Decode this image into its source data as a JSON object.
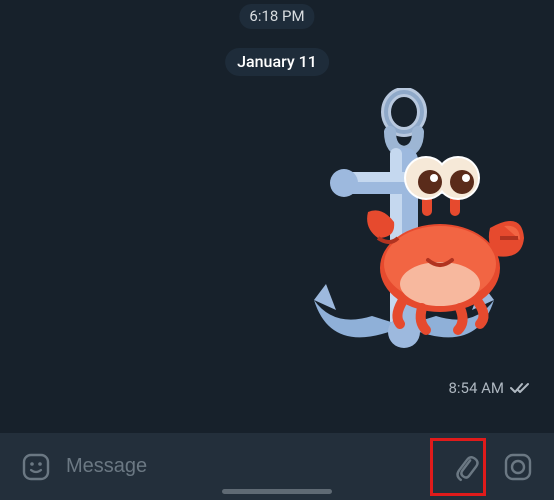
{
  "chat": {
    "prev_time": "6:18 PM",
    "date_separator": "January 11",
    "message": {
      "time": "8:54 AM",
      "status": "read"
    }
  },
  "composer": {
    "placeholder": "Message",
    "value": "",
    "sticker_icon": "sticker-icon",
    "attach_icon": "attach-icon",
    "camera_icon": "camera-icon"
  },
  "annotation": {
    "highlight": "attach-button"
  }
}
